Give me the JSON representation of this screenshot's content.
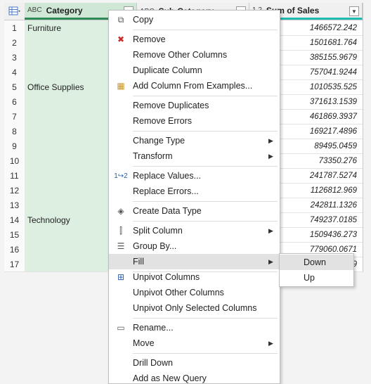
{
  "header": {
    "category": {
      "type_icon": "ABC",
      "label": "Category"
    },
    "subcategory": {
      "type_icon": "ABC",
      "label": "Sub-Category"
    },
    "sum": {
      "type_icon": "1.2",
      "label": "Sum of Sales"
    }
  },
  "rows": [
    {
      "n": "1",
      "category": "Furniture",
      "sum": "1466572.242"
    },
    {
      "n": "2",
      "category": "",
      "sum": "1501681.764"
    },
    {
      "n": "3",
      "category": "",
      "sum": "385155.9679"
    },
    {
      "n": "4",
      "category": "",
      "sum": "757041.9244"
    },
    {
      "n": "5",
      "category": "Office Supplies",
      "sum": "1010535.525"
    },
    {
      "n": "6",
      "category": "",
      "sum": "371613.1539"
    },
    {
      "n": "7",
      "category": "",
      "sum": "461869.3937"
    },
    {
      "n": "8",
      "category": "",
      "sum": "169217.4896"
    },
    {
      "n": "9",
      "category": "",
      "sum": "89495.0459"
    },
    {
      "n": "10",
      "category": "",
      "sum": "73350.276"
    },
    {
      "n": "11",
      "category": "",
      "sum": "241787.5274"
    },
    {
      "n": "12",
      "category": "",
      "sum": "1126812.969"
    },
    {
      "n": "13",
      "category": "",
      "sum": "242811.1326"
    },
    {
      "n": "14",
      "category": "Technology",
      "sum": "749237.0185"
    },
    {
      "n": "15",
      "category": "",
      "sum": "1509436.273"
    },
    {
      "n": "16",
      "category": "",
      "sum": "779060.0671"
    },
    {
      "n": "17",
      "category": "",
      "sum": "...39"
    }
  ],
  "menu": {
    "copy": "Copy",
    "remove": "Remove",
    "remove_other": "Remove Other Columns",
    "duplicate": "Duplicate Column",
    "add_from_examples": "Add Column From Examples...",
    "remove_duplicates": "Remove Duplicates",
    "remove_errors": "Remove Errors",
    "change_type": "Change Type",
    "transform": "Transform",
    "replace_values": "Replace Values...",
    "replace_errors": "Replace Errors...",
    "create_data_type": "Create Data Type",
    "split_column": "Split Column",
    "group_by": "Group By...",
    "fill": "Fill",
    "unpivot": "Unpivot Columns",
    "unpivot_other": "Unpivot Other Columns",
    "unpivot_selected": "Unpivot Only Selected Columns",
    "rename": "Rename...",
    "move": "Move",
    "drill_down": "Drill Down",
    "add_as_new_query": "Add as New Query"
  },
  "submenu": {
    "down": "Down",
    "up": "Up"
  }
}
